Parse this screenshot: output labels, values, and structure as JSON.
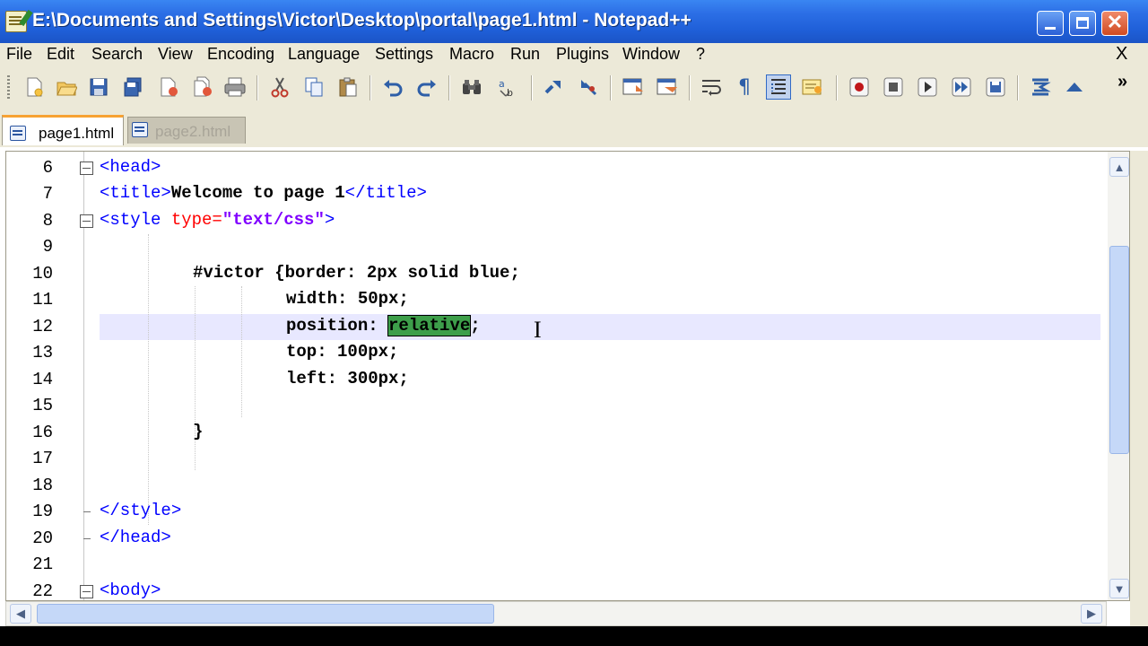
{
  "window": {
    "title": "E:\\Documents and Settings\\Victor\\Desktop\\portal\\page1.html - Notepad++",
    "close_glyph": "✕"
  },
  "menu": {
    "items": [
      "File",
      "Edit",
      "Search",
      "View",
      "Encoding",
      "Language",
      "Settings",
      "Macro",
      "Run",
      "Plugins",
      "Window",
      "?"
    ],
    "close_glyph": "X"
  },
  "toolbar": {
    "icons": [
      "new-file-icon",
      "open-file-icon",
      "save-icon",
      "save-all-icon",
      "close-icon",
      "close-all-icon",
      "print-icon",
      "cut-icon",
      "copy-icon",
      "paste-icon",
      "undo-icon",
      "redo-icon",
      "find-icon",
      "replace-icon",
      "zoom-in-icon",
      "zoom-out-icon",
      "sync-vertical-icon",
      "sync-horizontal-icon",
      "word-wrap-icon",
      "show-all-characters-icon",
      "indent-guide-icon",
      "user-language-icon",
      "record-macro-icon",
      "stop-record-icon",
      "playback-icon",
      "run-multiple-icon",
      "save-macro-icon",
      "trim-icon",
      "up-icon"
    ],
    "more_glyph": "»"
  },
  "tabs": [
    {
      "label": "page1.html",
      "active": true
    },
    {
      "label": "page2.html",
      "active": false
    }
  ],
  "editor": {
    "line_numbers": [
      "6",
      "7",
      "8",
      "9",
      "10",
      "11",
      "12",
      "13",
      "14",
      "15",
      "16",
      "17",
      "18",
      "19",
      "20",
      "21",
      "22"
    ],
    "lines": {
      "l6": {
        "tag": "<head>"
      },
      "l7": {
        "open": "<title>",
        "text": "Welcome to page 1",
        "close": "</title>"
      },
      "l8": {
        "open": "<style ",
        "attr": "type=",
        "value": "\"text/css\"",
        "close": ">"
      },
      "l10": "#victor {border: 2px solid blue;",
      "l11": "width: 50px;",
      "l12": {
        "before": "position: ",
        "selected": "relative",
        "after": ";"
      },
      "l13": "top: 100px;",
      "l14": "left: 300px;",
      "l16": "}",
      "l19": "</style>",
      "l20": "</head>",
      "l22": "<body>"
    },
    "current_line": "12"
  },
  "colors": {
    "tag": "#0000ff",
    "attribute": "#ff0000",
    "string": "#8000ff",
    "selection": "#3d9e4a",
    "current_line": "#e8e8ff",
    "title_bar": "#2c6fe6",
    "tab_accent": "#f7a233"
  }
}
